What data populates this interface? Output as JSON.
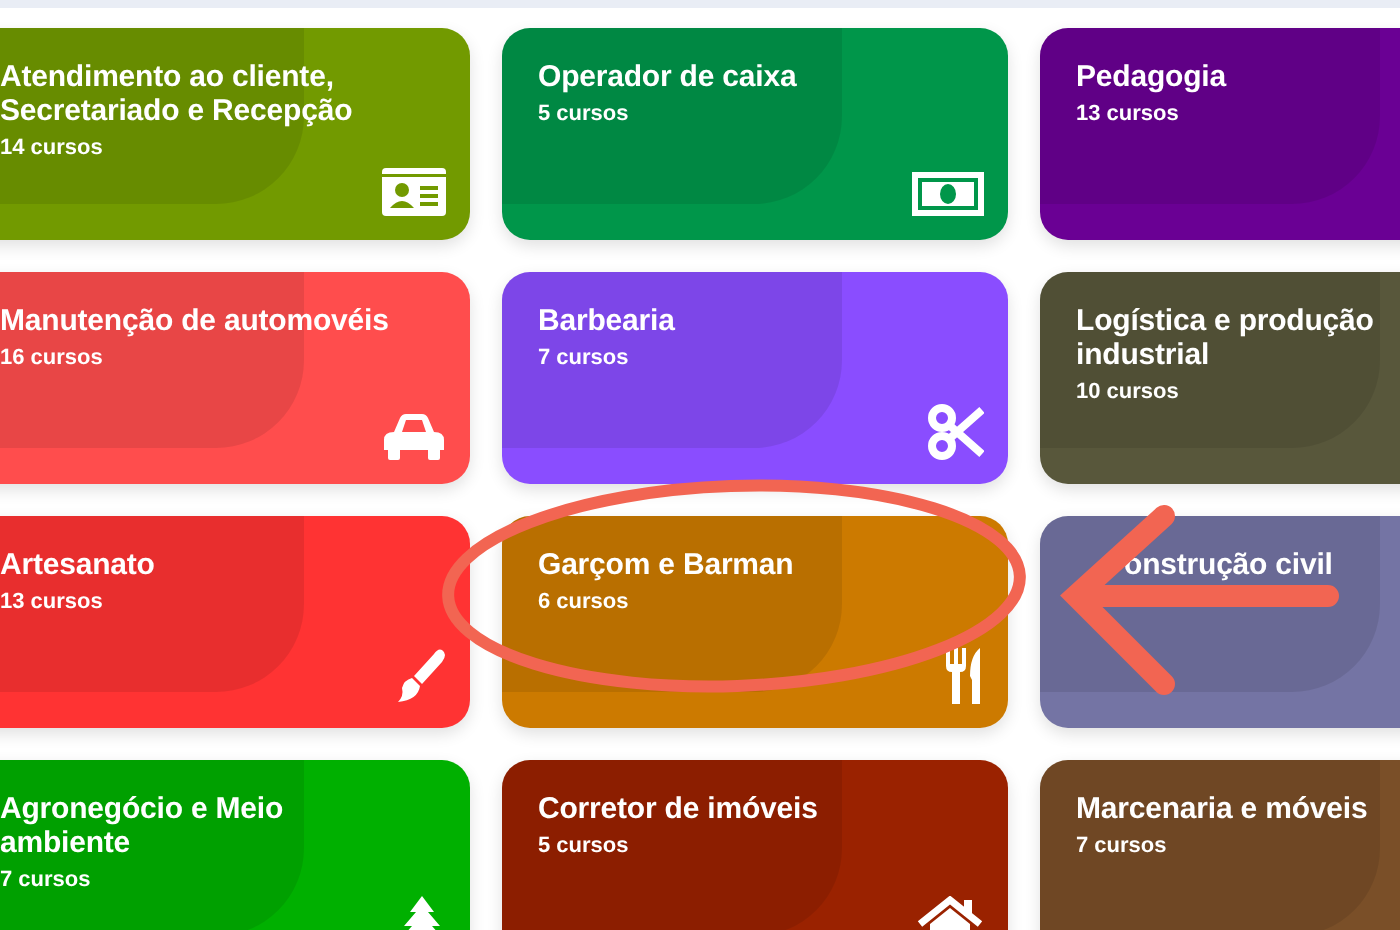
{
  "categories": [
    {
      "title": "Atendimento ao cliente, Secretariado e Recepção",
      "count": "14 cursos",
      "color": "#729a00"
    },
    {
      "title": "Operador de caixa",
      "count": "5 cursos",
      "color": "#00964a"
    },
    {
      "title": "Pedagogia",
      "count": "13 cursos",
      "color": "#6a0094"
    },
    {
      "title": "Manutenção de automovéis",
      "count": "16 cursos",
      "color": "#ff4d4d"
    },
    {
      "title": "Barbearia",
      "count": "7 cursos",
      "color": "#8a4dff"
    },
    {
      "title": "Logística e produção industrial",
      "count": "10 cursos",
      "color": "#58573b"
    },
    {
      "title": "Artesanato",
      "count": "13 cursos",
      "color": "#ff3333"
    },
    {
      "title": "Garçom e Barman",
      "count": "6 cursos",
      "color": "#cc7a00"
    },
    {
      "title": "onstrução civil",
      "color": "#7474a4"
    },
    {
      "title": "Agronegócio e Meio ambiente",
      "count": "7 cursos",
      "color": "#00b000"
    },
    {
      "title": "Corretor de imóveis",
      "count": "5 cursos",
      "color": "#9a2200"
    },
    {
      "title": "Marcenaria e móveis",
      "count": "7 cursos",
      "color": "#7a4f28"
    }
  ]
}
